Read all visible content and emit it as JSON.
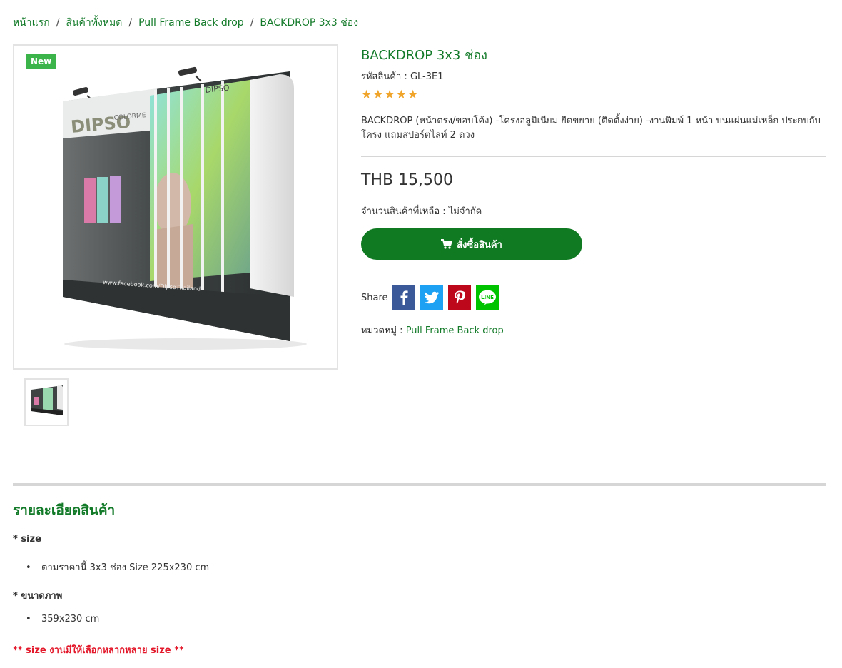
{
  "breadcrumb": {
    "items": [
      "หน้าแรก",
      "สินค้าทั้งหมด",
      "Pull Frame Back drop",
      "BACKDROP 3x3 ช่อง"
    ],
    "separator": "/"
  },
  "product": {
    "badge": "New",
    "backdrop_brand": "DIPSO",
    "backdrop_side_text": "COLORME",
    "backdrop_url": "www.facebook.com/DipsoThailand",
    "title": "BACKDROP 3x3 ช่อง",
    "sku_label": "รหัสสินค้า :",
    "sku": "GL-3E1",
    "rating": 5,
    "stars": "★★★★★",
    "description": "BACKDROP (หน้าตรง/ขอบโค้ง) -โครงอลูมิเนียม ยืดขยาย (ติดตั้งง่าย) -งานพิมพ์ 1 หน้า บนแผ่นแม่เหล็ก ประกบกับโครง แถมสปอร์ตไลท์ 2 ดวง",
    "price": "THB 15,500",
    "stock_label": "จำนวนสินค้าที่เหลือ :",
    "stock_value": "ไม่จำกัด",
    "buy_label": "สั่งซื้อสินค้า",
    "share_label": "Share",
    "category_label": "หมวดหมู่ :",
    "category": "Pull Frame Back drop"
  },
  "details": {
    "heading": "รายละเอียดสินค้า",
    "size_label": "* size",
    "size_item": "ตามราคานี้ 3x3 ช่อง Size 225x230 cm",
    "image_size_label": "* ขนาดภาพ",
    "image_size_item": "359x230 cm",
    "note": "**   size งานมีให้เลือกหลากหลาย size   **"
  },
  "colors": {
    "brand_green": "#127a28",
    "button_green": "#0f7a21",
    "badge_green": "#3bb54a",
    "star": "#f0a52a",
    "note_red": "#e3192b",
    "facebook": "#3b5998",
    "twitter": "#1da1f2",
    "pinterest": "#bd081c",
    "line": "#00c300"
  }
}
